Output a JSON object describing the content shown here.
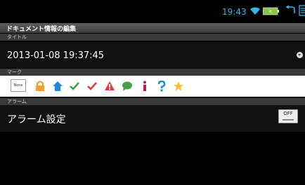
{
  "status": {
    "time": "19:43"
  },
  "screen": {
    "title": "ドキュメント情報の編集"
  },
  "sections": {
    "title_header": "タイトル",
    "title_value": "2013-01-08 19:37:45",
    "mark_header": "マーク",
    "none_label": "None",
    "alarm_header": "アラーム",
    "alarm_label": "アラーム設定",
    "alarm_toggle": "OFF"
  },
  "marks": [
    "lock",
    "home",
    "check-green",
    "check-red",
    "warning",
    "speech",
    "info",
    "question",
    "star"
  ],
  "colors": {
    "accent": "#33b5e5"
  }
}
